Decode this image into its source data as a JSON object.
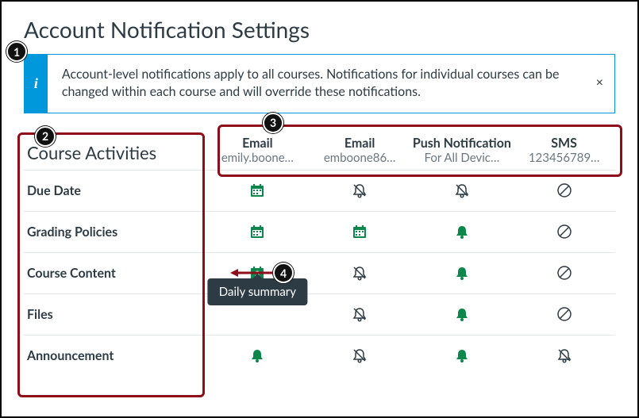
{
  "title": "Account Notification Settings",
  "banner": {
    "text": "Account-level notifications apply to all courses. Notifications for individual courses can be changed within each course and will override these notifications.",
    "close": "×",
    "icon": "i"
  },
  "section_title": "Course Activities",
  "columns": [
    {
      "label": "Email",
      "sub": "emily.boone…"
    },
    {
      "label": "Email",
      "sub": "emboone86…"
    },
    {
      "label": "Push Notification",
      "sub": "For All Devic…"
    },
    {
      "label": "SMS",
      "sub": "123456789…"
    }
  ],
  "rows": [
    {
      "label": "Due Date",
      "cells": [
        "calendar",
        "bell-off",
        "bell-off",
        "block"
      ]
    },
    {
      "label": "Grading Policies",
      "cells": [
        "calendar",
        "calendar",
        "bell",
        "block"
      ]
    },
    {
      "label": "Course Content",
      "cells": [
        "calendar-num",
        "bell-off",
        "bell",
        "block"
      ],
      "tooltip": true,
      "ann4": true
    },
    {
      "label": "Files",
      "cells": [
        "empty",
        "bell-off",
        "bell",
        "block"
      ]
    },
    {
      "label": "Announcement",
      "cells": [
        "bell",
        "bell-off",
        "bell",
        "bell-off"
      ]
    }
  ],
  "tooltip_text": "Daily summary",
  "annotations": {
    "1": "1",
    "2": "2",
    "3": "3",
    "4": "4"
  }
}
